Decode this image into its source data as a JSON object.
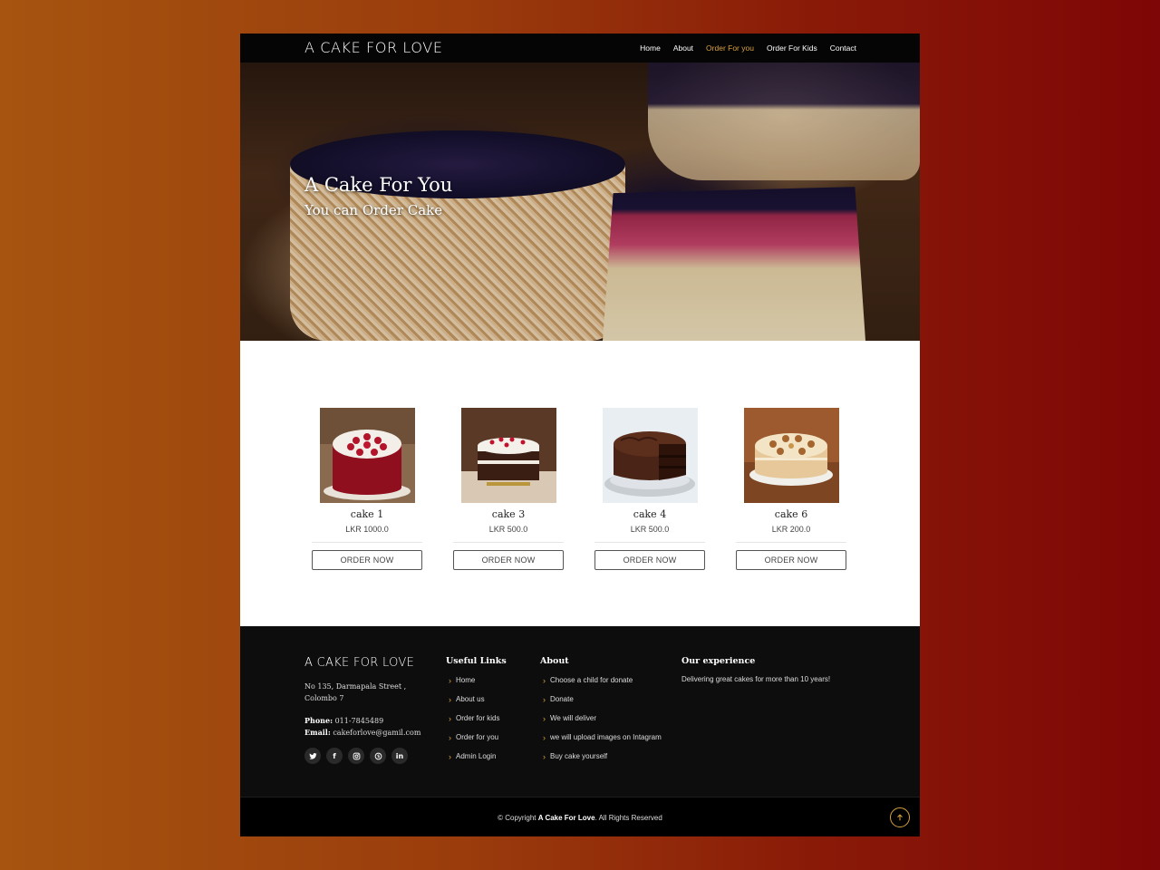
{
  "header": {
    "brand": "A CAKE FOR LOVE",
    "nav": [
      {
        "label": "Home",
        "active": false
      },
      {
        "label": "About",
        "active": false
      },
      {
        "label": "Order For you",
        "active": true
      },
      {
        "label": "Order For Kids",
        "active": false
      },
      {
        "label": "Contact",
        "active": false
      }
    ]
  },
  "hero": {
    "title": "A Cake For You",
    "subtitle": "You can Order Cake"
  },
  "products": [
    {
      "name": "cake 1",
      "price": "LKR 1000.0",
      "button": "ORDER NOW"
    },
    {
      "name": "cake 3",
      "price": "LKR 500.0",
      "button": "ORDER NOW"
    },
    {
      "name": "cake 4",
      "price": "LKR 500.0",
      "button": "ORDER NOW"
    },
    {
      "name": "cake 6",
      "price": "LKR 200.0",
      "button": "ORDER NOW"
    }
  ],
  "footer": {
    "brand": "A CAKE FOR LOVE",
    "address_line1": "No 135, Darmapala Street ,",
    "address_line2": "Colombo 7",
    "phone_label": "Phone:",
    "phone": "011-7845489",
    "email_label": "Email:",
    "email": "cakeforlove@gamil.com",
    "socials": [
      "twitter-icon",
      "facebook-icon",
      "instagram-icon",
      "skype-icon",
      "linkedin-icon"
    ],
    "useful_links": {
      "title": "Useful Links",
      "items": [
        "Home",
        "About us",
        "Order for kids",
        "Order for you",
        "Admin Login"
      ]
    },
    "about": {
      "title": "About",
      "items": [
        "Choose a child for donate",
        "Donate",
        "We will deliver",
        "we will upload images on Intagram",
        "Buy cake yourself"
      ]
    },
    "experience": {
      "title": "Our experience",
      "text": "Delivering great cakes for more than 10 years!"
    }
  },
  "bottom": {
    "copy_prefix": "© Copyright",
    "copy_brand": "A Cake For Love",
    "copy_suffix": ". All Rights Reserved"
  },
  "colors": {
    "accent": "#d9a23f",
    "header_bg": "#050505",
    "footer_bg": "#0d0d0d"
  }
}
